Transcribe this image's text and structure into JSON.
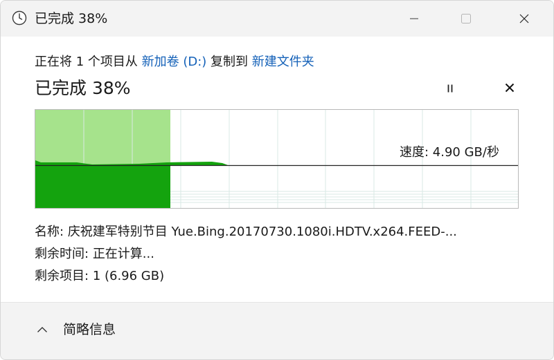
{
  "window": {
    "title": "已完成 38%"
  },
  "copy": {
    "prefix": "正在将 1 个项目从 ",
    "source": "新加卷 (D:)",
    "middle": " 复制到 ",
    "destination": "新建文件夹"
  },
  "progress": {
    "label": "已完成 38%",
    "fraction": 0.38,
    "speed_label": "速度: 4.90 GB/秒"
  },
  "details": {
    "name_label": "名称:",
    "name_value": "庆祝建军特别节目 Yue.Bing.20170730.1080i.HDTV.x264.FEED-...",
    "time_label": "剩余时间:",
    "time_value": "正在计算...",
    "items_label": "剩余项目:",
    "items_value": "1 (6.96 GB)"
  },
  "footer": {
    "toggle_label": "简略信息"
  },
  "colors": {
    "fill_dark": "#14a30e",
    "fill_light": "#a6e38c",
    "link": "#1461b8",
    "titlebar": "#f3f3f3"
  },
  "icons": {
    "title": "clock-icon",
    "minimize": "minimize-icon",
    "maximize": "maximize-icon",
    "close": "close-icon",
    "pause": "pause-icon",
    "cancel": "cancel-icon",
    "toggle": "chevron-up-icon"
  }
}
